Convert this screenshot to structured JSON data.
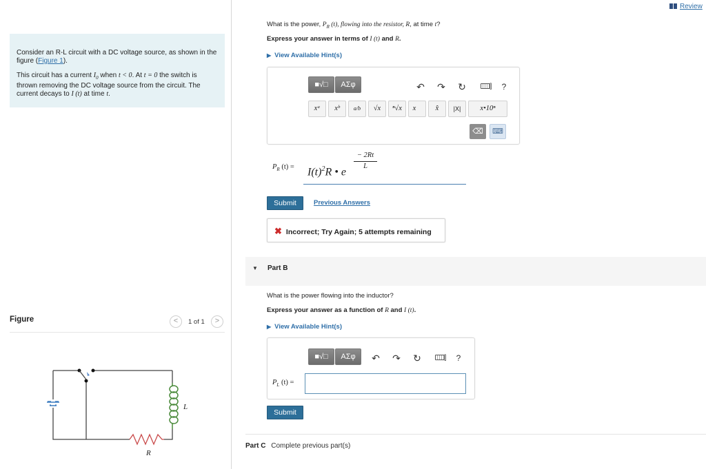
{
  "review": {
    "label": "Review"
  },
  "problem": {
    "p1_a": "Consider an R-L circuit with a DC voltage source, as shown in the figure (",
    "p1_link": "Figure 1",
    "p1_b": ").",
    "p2_a": "This circuit has a current ",
    "p2_i0": "I",
    "p2_i0_sub": "0",
    "p2_b": " when ",
    "p2_t1": "t < 0",
    "p2_c": ". At ",
    "p2_t2": "t = 0",
    "p2_d": " the switch is thrown removing the DC voltage source from the circuit. The current decays to ",
    "p2_it": "I (t)",
    "p2_e": " at time ",
    "p2_t3": "t",
    "p2_f": "."
  },
  "figure": {
    "heading": "Figure",
    "pager": "1 of 1",
    "prev_symbol": "<",
    "next_symbol": ">",
    "label_L": "L",
    "label_R": "R"
  },
  "part_a": {
    "question_a": "What is the power, ",
    "question_p": "P",
    "question_p_sub": "R",
    "question_b": " (t), flowing into the resistor, ",
    "question_r": "R",
    "question_c": ", at time ",
    "question_t": "t",
    "question_d": "?",
    "instruction_a": "Express your answer in terms of ",
    "instruction_i": "I (t)",
    "instruction_b": " and ",
    "instruction_r": "R",
    "instruction_c": ".",
    "hint": "View Available Hint(s)",
    "answer_label": "P",
    "answer_label_sub": "R",
    "answer_label_rest": " (t) =",
    "answer_value": {
      "base": "I(t)",
      "sup": "2",
      "mid": "R • e",
      "exp_num": "− 2Rt",
      "exp_den": "L"
    },
    "submit": "Submit",
    "previous_answers": "Previous Answers",
    "feedback": "Incorrect; Try Again; 5 attempts remaining",
    "feedback_icon": "✖"
  },
  "toolbar": {
    "templates_icon": "■√□",
    "greek": "ΑΣφ",
    "undo": "↶",
    "redo": "↷",
    "reset": "↻",
    "keyboard_suffix": "]",
    "help": "?",
    "symbols": [
      "xᵃ",
      "xᵇ",
      "a/b",
      "√x",
      "ⁿ√x",
      "x⃗",
      "x̂",
      "|X|",
      "x•10ⁿ"
    ],
    "backspace": "⌫",
    "keyboard_toggle": "⌨"
  },
  "part_b": {
    "label": "Part B",
    "collapse_icon": "▼",
    "question": "What is the power flowing into the inductor?",
    "instruction_a": "Express your answer as a function of ",
    "instruction_r": "R",
    "instruction_b": " and ",
    "instruction_i": "I (t)",
    "instruction_c": ".",
    "hint": "View Available Hint(s)",
    "answer_label": "P",
    "answer_label_sub": "L",
    "answer_label_rest": " (t) =",
    "answer_value": "",
    "submit": "Submit"
  },
  "part_c": {
    "label": "Part C",
    "text": "Complete previous part(s)"
  }
}
